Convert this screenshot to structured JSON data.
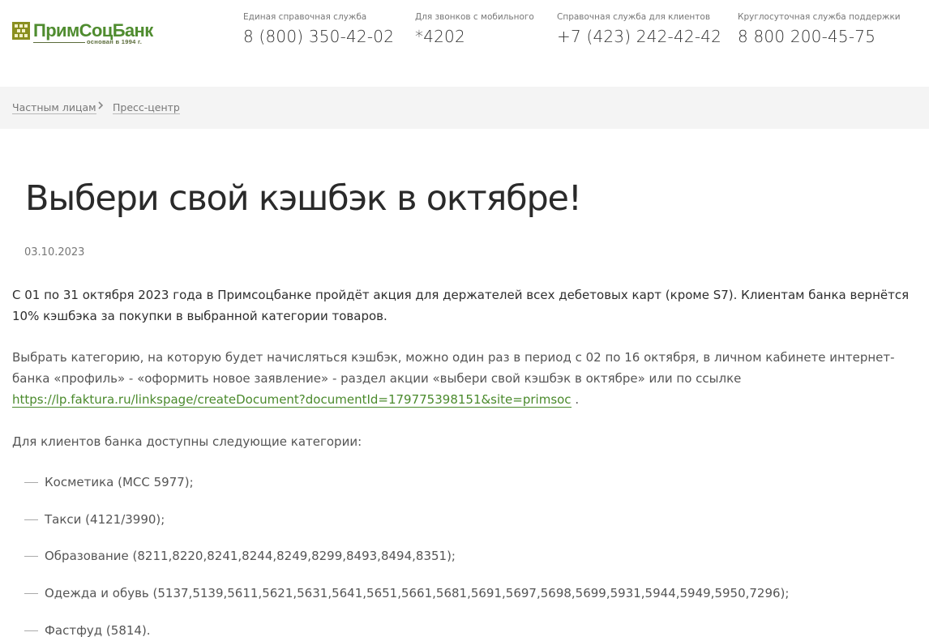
{
  "brand": {
    "name": "ПримСоцБанк",
    "subtitle": "основан в 1994 г.",
    "color": "#4f8c2f"
  },
  "header": {
    "contacts": [
      {
        "label": "Единая справочная служба",
        "phone": "8 (800) 350-42-02"
      },
      {
        "label": "Для звонков с мобильного",
        "phone": "*4202"
      },
      {
        "label": "Справочная служба для клиентов",
        "phone": "+7 (423) 242-42-42"
      },
      {
        "label": "Круглосуточная служба поддержки",
        "phone": "8 800 200-45-75"
      }
    ]
  },
  "breadcrumb": {
    "items": [
      {
        "label": "Частным лицам"
      },
      {
        "label": "Пресс-центр"
      }
    ],
    "separator_icon": "chevron-right-icon"
  },
  "article": {
    "title": "Выбери свой кэшбэк в октябре!",
    "date": "03.10.2023",
    "p1": "С 01 по 31 октября 2023 года в Примсоцбанке пройдёт акция для держателей всех дебетовых карт (кроме S7). Клиентам банка вернётся 10% кэшбэка за покупки в выбранной категории товаров.",
    "p2_before_link": "Выбрать категорию, на которую будет начисляться кэшбэк, можно один раз в период с 02 по 16 октября, в личном кабинете интернет-банка «профиль» - «оформить новое заявление» - раздел акции «выбери свой кэшбэк в октябре» или по ссылке ",
    "p2_link": "https://lp.faktura.ru/linkspage/createDocument?documentId=179775398151&site=primsoc",
    "p2_after_link": " .",
    "p3": "Для клиентов банка доступны следующие категории:",
    "categories": [
      "Косметика (MCC 5977);",
      "Такси (4121/3990);",
      "Образование (8211,8220,8241,8244,8249,8299,8493,8494,8351);",
      "Одежда и обувь (5137,5139,5611,5621,5631,5641,5651,5661,5681,5691,5697,5698,5699,5931,5944,5949,5950,7296);",
      "Фастфуд (5814)."
    ]
  }
}
